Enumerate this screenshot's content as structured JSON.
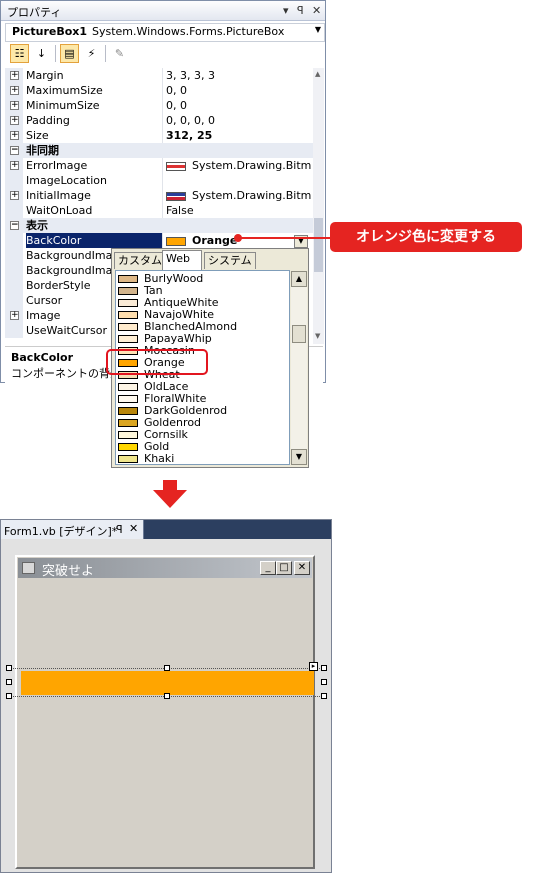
{
  "properties_window": {
    "title": "プロパティ",
    "title_buttons": [
      "▾",
      "ꟼ",
      "✕"
    ],
    "object_name": "PictureBox1",
    "object_type": "System.Windows.Forms.PictureBox",
    "toolbar_icons": [
      "categorized-icon",
      "alphabetical-icon",
      "properties-icon",
      "events-icon",
      "property-pages-icon"
    ],
    "rows": [
      {
        "type": "prop",
        "expand": "+",
        "name": "Margin",
        "value": "3, 3, 3, 3"
      },
      {
        "type": "prop",
        "expand": "+",
        "name": "MaximumSize",
        "value": "0, 0"
      },
      {
        "type": "prop",
        "expand": "+",
        "name": "MinimumSize",
        "value": "0, 0"
      },
      {
        "type": "prop",
        "expand": "+",
        "name": "Padding",
        "value": "0, 0, 0, 0"
      },
      {
        "type": "prop",
        "expand": "+",
        "name": "Size",
        "value": "312, 25",
        "bold": true
      },
      {
        "type": "cat",
        "expand": "−",
        "name": "非同期"
      },
      {
        "type": "prop",
        "expand": "+",
        "name": "ErrorImage",
        "value": "System.Drawing.Bitmap",
        "icon": "error-image-icon"
      },
      {
        "type": "prop",
        "expand": "",
        "name": "ImageLocation",
        "value": ""
      },
      {
        "type": "prop",
        "expand": "+",
        "name": "InitialImage",
        "value": "System.Drawing.Bitmap",
        "icon": "initial-image-icon"
      },
      {
        "type": "prop",
        "expand": "",
        "name": "WaitOnLoad",
        "value": "False"
      },
      {
        "type": "cat",
        "expand": "−",
        "name": "表示"
      },
      {
        "type": "prop",
        "expand": "",
        "name": "BackColor",
        "value": "Orange",
        "bold": true,
        "swatch": "#ffa500",
        "selected": true
      },
      {
        "type": "prop",
        "expand": "",
        "name": "BackgroundImage",
        "value": ""
      },
      {
        "type": "prop",
        "expand": "",
        "name": "BackgroundImageLayout",
        "value": ""
      },
      {
        "type": "prop",
        "expand": "",
        "name": "BorderStyle",
        "value": ""
      },
      {
        "type": "prop",
        "expand": "",
        "name": "Cursor",
        "value": ""
      },
      {
        "type": "prop",
        "expand": "+",
        "name": "Image",
        "value": ""
      },
      {
        "type": "prop",
        "expand": "",
        "name": "UseWaitCursor",
        "value": ""
      }
    ],
    "description_title": "BackColor",
    "description_text": "コンポーネントの背景"
  },
  "color_popup": {
    "tabs": [
      "カスタム",
      "Web",
      "システム"
    ],
    "active_tab": "Web",
    "items": [
      {
        "name": "BurlyWood",
        "color": "#deb887"
      },
      {
        "name": "Tan",
        "color": "#d2b48c"
      },
      {
        "name": "AntiqueWhite",
        "color": "#faebd7"
      },
      {
        "name": "NavajoWhite",
        "color": "#ffdead"
      },
      {
        "name": "BlanchedAlmond",
        "color": "#ffebcd"
      },
      {
        "name": "PapayaWhip",
        "color": "#ffefd5"
      },
      {
        "name": "Moccasin",
        "color": "#ffe4b5"
      },
      {
        "name": "Orange",
        "color": "#ffa500"
      },
      {
        "name": "Wheat",
        "color": "#f5deb3"
      },
      {
        "name": "OldLace",
        "color": "#fdf5e6"
      },
      {
        "name": "FloralWhite",
        "color": "#fffaf0"
      },
      {
        "name": "DarkGoldenrod",
        "color": "#b8860b"
      },
      {
        "name": "Goldenrod",
        "color": "#daa520"
      },
      {
        "name": "Cornsilk",
        "color": "#fff8dc"
      },
      {
        "name": "Gold",
        "color": "#ffd700"
      },
      {
        "name": "Khaki",
        "color": "#f0e68c"
      }
    ],
    "highlighted_item": "Orange"
  },
  "callout": {
    "text": "オレンジ色に変更する",
    "color": "#e52421"
  },
  "designer": {
    "tab_label": "Form1.vb [デザイン]*",
    "pin_glyph": "ꟼ",
    "close_glyph": "✕",
    "form_title": "突破せよ",
    "window_buttons": [
      "_",
      "□",
      "✕"
    ],
    "picturebox_color": "#ffa500"
  }
}
